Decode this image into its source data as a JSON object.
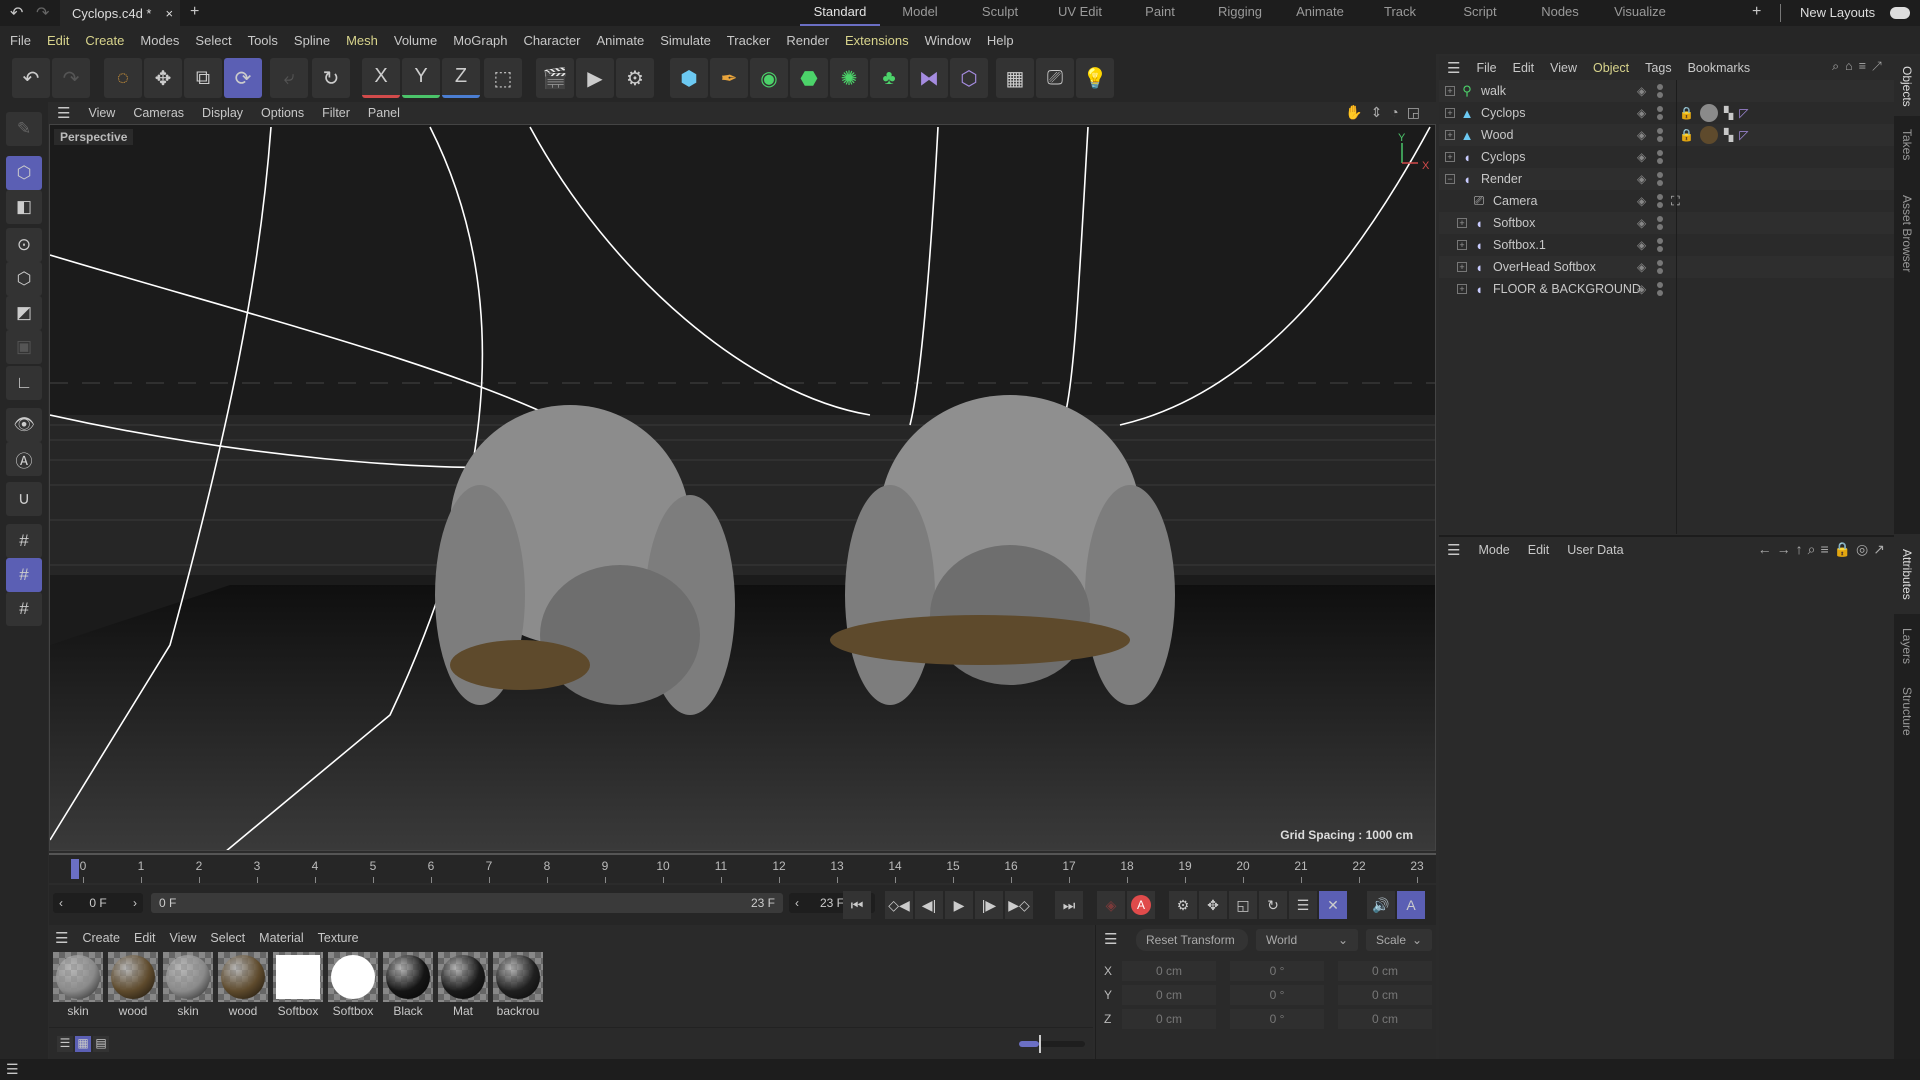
{
  "tabbar": {
    "doc_title": "Cyclops.c4d *",
    "close": "×",
    "add": "+",
    "layouts": [
      "Standard",
      "Model",
      "Sculpt",
      "UV Edit",
      "Paint",
      "Rigging",
      "Animate",
      "Track",
      "Script",
      "Nodes",
      "Visualize"
    ],
    "active_layout": "Standard",
    "new_layouts": "New Layouts"
  },
  "menubar": [
    "File",
    "Edit",
    "Create",
    "Modes",
    "Select",
    "Tools",
    "Spline",
    "Mesh",
    "Volume",
    "MoGraph",
    "Character",
    "Animate",
    "Simulate",
    "Tracker",
    "Render",
    "Extensions",
    "Window",
    "Help"
  ],
  "toolbar": {
    "axis_x": "X",
    "axis_y": "Y",
    "axis_z": "Z"
  },
  "viewport": {
    "menu": [
      "View",
      "Cameras",
      "Display",
      "Options",
      "Filter",
      "Panel"
    ],
    "camera_label": "Perspective",
    "grid_spacing": "Grid Spacing : 1000 cm",
    "axis_x": "X",
    "axis_y": "Y"
  },
  "timeline": {
    "ticks": [
      "0",
      "1",
      "2",
      "3",
      "4",
      "5",
      "6",
      "7",
      "8",
      "9",
      "10",
      "11",
      "12",
      "13",
      "14",
      "15",
      "16",
      "17",
      "18",
      "19",
      "20",
      "21",
      "22",
      "23"
    ],
    "current_frame": "0 F",
    "range_start": "0 F",
    "range_end": "23 F",
    "end_frame": "23 F"
  },
  "materials": {
    "menu": [
      "Create",
      "Edit",
      "View",
      "Select",
      "Material",
      "Texture"
    ],
    "items": [
      {
        "name": "skin",
        "color": "#8a8a8a"
      },
      {
        "name": "wood",
        "color": "#5e4a2c"
      },
      {
        "name": "skin",
        "color": "#8a8a8a"
      },
      {
        "name": "wood",
        "color": "#5e4a2c"
      },
      {
        "name": "Softbox",
        "color": "#ffffff"
      },
      {
        "name": "Softbox",
        "color": "#ffffff"
      },
      {
        "name": "Black",
        "color": "#151515"
      },
      {
        "name": "Mat",
        "color": "#1a1a1a"
      },
      {
        "name": "backrou",
        "color": "#202020"
      }
    ]
  },
  "coordinates": {
    "reset": "Reset Transform",
    "space": "World",
    "mode": "Scale",
    "rows": [
      {
        "axis": "X",
        "pos": "0 cm",
        "rot": "0 °",
        "scale": "0 cm"
      },
      {
        "axis": "Y",
        "pos": "0 cm",
        "rot": "0 °",
        "scale": "0 cm"
      },
      {
        "axis": "Z",
        "pos": "0 cm",
        "rot": "0 °",
        "scale": "0 cm"
      }
    ]
  },
  "objects": {
    "menu": [
      "File",
      "Edit",
      "View",
      "Object",
      "Tags",
      "Bookmarks"
    ],
    "items": [
      {
        "name": "walk",
        "expand": "+"
      },
      {
        "name": "Cyclops",
        "expand": "+"
      },
      {
        "name": "Wood",
        "expand": "+"
      },
      {
        "name": "Cyclops",
        "expand": "+"
      },
      {
        "name": "Render",
        "expand": "−"
      },
      {
        "name": "Camera",
        "expand": ""
      },
      {
        "name": "Softbox",
        "expand": "+"
      },
      {
        "name": "Softbox.1",
        "expand": "+"
      },
      {
        "name": "OverHead Softbox",
        "expand": "+"
      },
      {
        "name": "FLOOR & BACKGROUND",
        "expand": "+"
      }
    ]
  },
  "attributes": {
    "menu": [
      "Mode",
      "Edit",
      "User Data"
    ]
  },
  "side_tabs": [
    "Objects",
    "Takes",
    "Asset Browser",
    "Attributes",
    "Layers",
    "Structure"
  ],
  "colors": {
    "accent": "#5b5fb4",
    "highlight_menu": "#d8d48c"
  }
}
